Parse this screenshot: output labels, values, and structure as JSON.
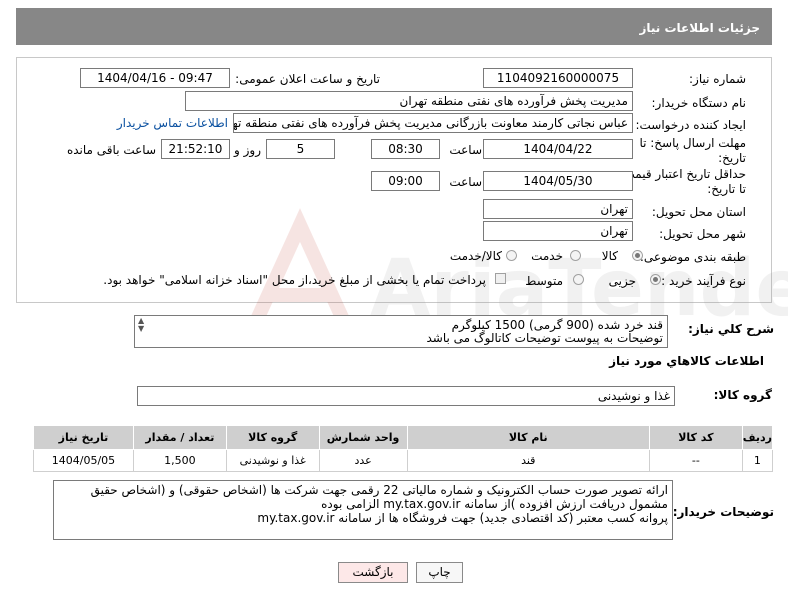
{
  "header": {
    "title": "جزئیات اطلاعات نیاز"
  },
  "fields": {
    "need_number_label": "شماره نیاز:",
    "need_number": "1104092160000075",
    "announce_label": "تاریخ و ساعت اعلان عمومی:",
    "announce_value": "1404/04/16 - 09:47",
    "buyer_org_label": "نام دستگاه خریدار:",
    "buyer_org": "مدیریت پخش فرآورده های نفتی منطقه تهران",
    "requester_label": "ایجاد کننده درخواست:",
    "requester": "عباس نجاتی کارمند معاونت بازرگانی مدیریت پخش فرآورده های نفتی منطقه تهران",
    "contact_link": "اطلاعات تماس خریدار",
    "deadline_label_1": "مهلت ارسال پاسخ: تا",
    "deadline_label_2": "تاریخ:",
    "deadline_date": "1404/04/22",
    "time_label": "ساعت",
    "deadline_time": "08:30",
    "days_value": "5",
    "days_label": "روز و",
    "remaining_time": "21:52:10",
    "remaining_label": "ساعت باقی مانده",
    "price_label_1": "حداقل تاریخ اعتبار قیمت:",
    "price_label_2": "تا تاریخ:",
    "price_date": "1404/05/30",
    "price_time": "09:00",
    "province_label": "استان محل تحویل:",
    "province": "تهران",
    "city_label": "شهر محل تحویل:",
    "city": "تهران",
    "category_label": "طبقه بندی موضوعی:",
    "category_options": [
      "کالا",
      "خدمت",
      "کالا/خدمت"
    ],
    "process_label": "نوع فرآیند خرید :",
    "process_options": [
      "جزیی",
      "متوسط"
    ],
    "payment_note": "پرداخت تمام یا بخشی از مبلغ خرید،از محل \"اسناد خزانه اسلامی\" خواهد بود."
  },
  "description": {
    "label": "شرح کلي نياز:",
    "line1": "قند خرد شده (900 گرمی)  1500 کیلوگرم",
    "line2": "توضیحات به پیوست توضیحات کاتالوگ می باشد"
  },
  "goods": {
    "section_title": "اطلاعات کالاهاي مورد نياز",
    "group_label": "گروه کالا:",
    "group_value": "غذا و نوشیدنی",
    "columns": [
      "رديف",
      "کد کالا",
      "نام کالا",
      "واحد شمارش",
      "گروه کالا",
      "تعداد / مقدار",
      "تاریخ نیاز"
    ],
    "rows": [
      [
        "1",
        "--",
        "قند",
        "عدد",
        "غذا و نوشیدنی",
        "1,500",
        "1404/05/05"
      ]
    ]
  },
  "buyer_notes": {
    "label": "توضیحات خریدار:",
    "line1": "ارائه  تصویر صورت حساب الکترونیک و شماره مالیاتی 22 رقمی  جهت شرکت ها (اشخاص حقوقی) و (اشخاص حقیق",
    "line2": "مشمول دریافت ارزش افزوده )از سامانه  my.tax.gov.ir  الزامی بوده",
    "line3": "پروانه کسب معتبر (کد اقتصادی جدید) جهت فروشگاه ها از سامانه my.tax.gov.ir"
  },
  "buttons": {
    "print": "چاپ",
    "back": "بازگشت"
  },
  "colors": {
    "header_bg": "#878787",
    "table_header_bg": "#cfcfcf",
    "link": "#0a50a0",
    "back_button_bg": "#fde8e8"
  }
}
